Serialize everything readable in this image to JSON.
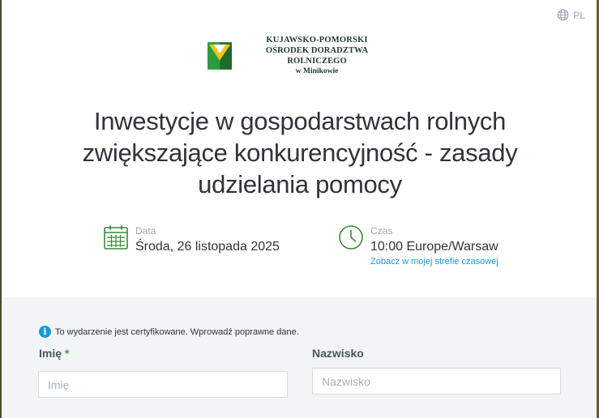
{
  "language": {
    "code": "PL",
    "icon": "globe-icon"
  },
  "logo": {
    "line1": "KUJAWSKO-POMORSKI",
    "line2": "OŚRODEK DORADZTWA ROLNICZEGO",
    "line3": "w Minikowie",
    "colors": {
      "green": "#2e9a3c",
      "yellow": "#f2c418",
      "dark": "#1f3a2a"
    }
  },
  "event": {
    "title": "Inwestycje w gospodarstwach rolnych zwiększające konkurencyjność - zasady udzielania pomocy",
    "date_label": "Data",
    "date_value": "Środa, 26 listopada 2025",
    "time_label": "Czas",
    "time_value": "10:00 Europe/Warsaw",
    "timezone_link": "Zobacz w mojej strefie czasowej"
  },
  "form": {
    "notice": "To wydarzenie jest certyfikowane. Wprowadź poprawne dane.",
    "first_name": {
      "label": "Imię",
      "required_mark": "*",
      "placeholder": "Imię",
      "value": ""
    },
    "last_name": {
      "label": "Nazwisko",
      "placeholder": "Nazwisko",
      "value": ""
    }
  },
  "colors": {
    "accent_green": "#2e9a4a",
    "link_blue": "#1a9bd7",
    "form_bg": "#f3f4f6"
  }
}
